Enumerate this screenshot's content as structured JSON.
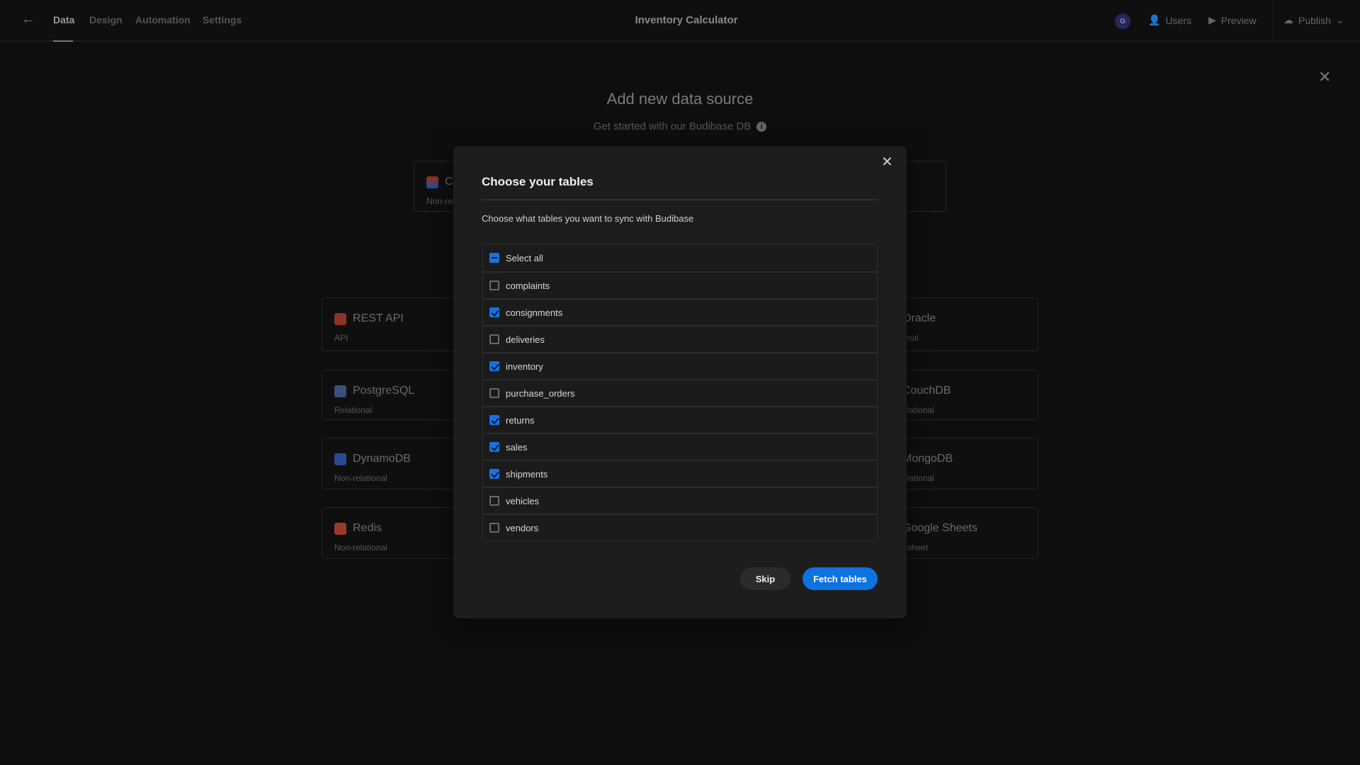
{
  "header": {
    "tabs": [
      {
        "label": "Data",
        "active": true
      },
      {
        "label": "Design"
      },
      {
        "label": "Automation"
      },
      {
        "label": "Settings"
      }
    ],
    "title": "Inventory Calculator",
    "avatar_initial": "G",
    "users": "Users",
    "preview": "Preview",
    "publish": "Publish"
  },
  "page": {
    "title": "Add new data source",
    "subtitle": "Get started with our Budibase DB",
    "budibase_card": {
      "name": "Cr",
      "desc": "Non-rel"
    },
    "sources": [
      {
        "name": "REST API",
        "desc": "API",
        "color": "#8a3326"
      },
      {
        "name": "PostgreSQL",
        "desc": "Relational",
        "color": "#3a4f7a"
      },
      {
        "name": "DynamoDB",
        "desc": "Non-relational",
        "color": "#2b4a8f"
      },
      {
        "name": "Redis",
        "desc": "Non-relational",
        "color": "#9a3a2a"
      },
      {
        "name": "Oracle",
        "desc": "onal"
      },
      {
        "name": "CouchDB",
        "desc": "elational"
      },
      {
        "name": "MongoDB",
        "desc": "elational"
      },
      {
        "name": "Google Sheets",
        "desc": "dsheet"
      }
    ]
  },
  "modal": {
    "title": "Choose your tables",
    "description": "Choose what tables you want to sync with Budibase",
    "select_all": {
      "label": "Select all",
      "state": "mixed"
    },
    "tables": [
      {
        "name": "complaints",
        "checked": false
      },
      {
        "name": "consignments",
        "checked": true
      },
      {
        "name": "deliveries",
        "checked": false
      },
      {
        "name": "inventory",
        "checked": true
      },
      {
        "name": "purchase_orders",
        "checked": false
      },
      {
        "name": "returns",
        "checked": true
      },
      {
        "name": "sales",
        "checked": true
      },
      {
        "name": "shipments",
        "checked": true
      },
      {
        "name": "vehicles",
        "checked": false
      },
      {
        "name": "vendors",
        "checked": false
      }
    ],
    "skip": "Skip",
    "fetch": "Fetch tables"
  },
  "colors": {
    "accent": "#0d73e0",
    "background": "#0e0e0e",
    "modal": "#1d1d1d"
  }
}
